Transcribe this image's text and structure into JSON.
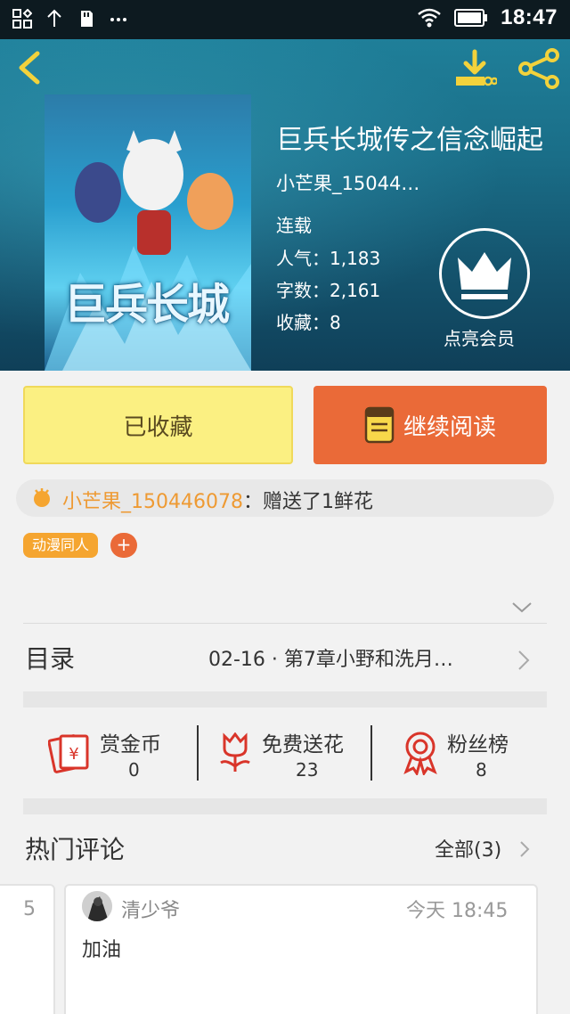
{
  "status_bar": {
    "time": "18:47"
  },
  "book": {
    "title": "巨兵长城传之信念崛起",
    "author": "小芒果_15044…",
    "status": "连载",
    "popularity": "人气：1,183",
    "word_count": "字数：2,161",
    "collections": "收藏：8",
    "cover_text": "巨兵长城",
    "vip_label": "点亮会员"
  },
  "actions": {
    "favorited_label": "已收藏",
    "continue_label": "继续阅读"
  },
  "gift": {
    "user": "小芒果_150446078",
    "message": "：赠送了1鲜花"
  },
  "tags": [
    {
      "label": "动漫同人"
    }
  ],
  "tag_add_label": "+",
  "toc": {
    "label": "目录",
    "latest": "02-16 · 第7章小野和洗月…"
  },
  "stats": [
    {
      "label": "赏金币",
      "value": "0"
    },
    {
      "label": "免费送花",
      "value": "23"
    },
    {
      "label": "粉丝榜",
      "value": "8"
    }
  ],
  "comments": {
    "title": "热门评论",
    "all_label": "全部(3)",
    "prev_card_text": "5",
    "items": [
      {
        "user": "清少爷",
        "time": "今天 18:45",
        "text": "加油"
      }
    ]
  },
  "colors": {
    "accent_orange": "#ea6a38",
    "favorite_yellow": "#fbf082",
    "gift_user": "#ee9a33",
    "tag_orange": "#f5a530"
  }
}
